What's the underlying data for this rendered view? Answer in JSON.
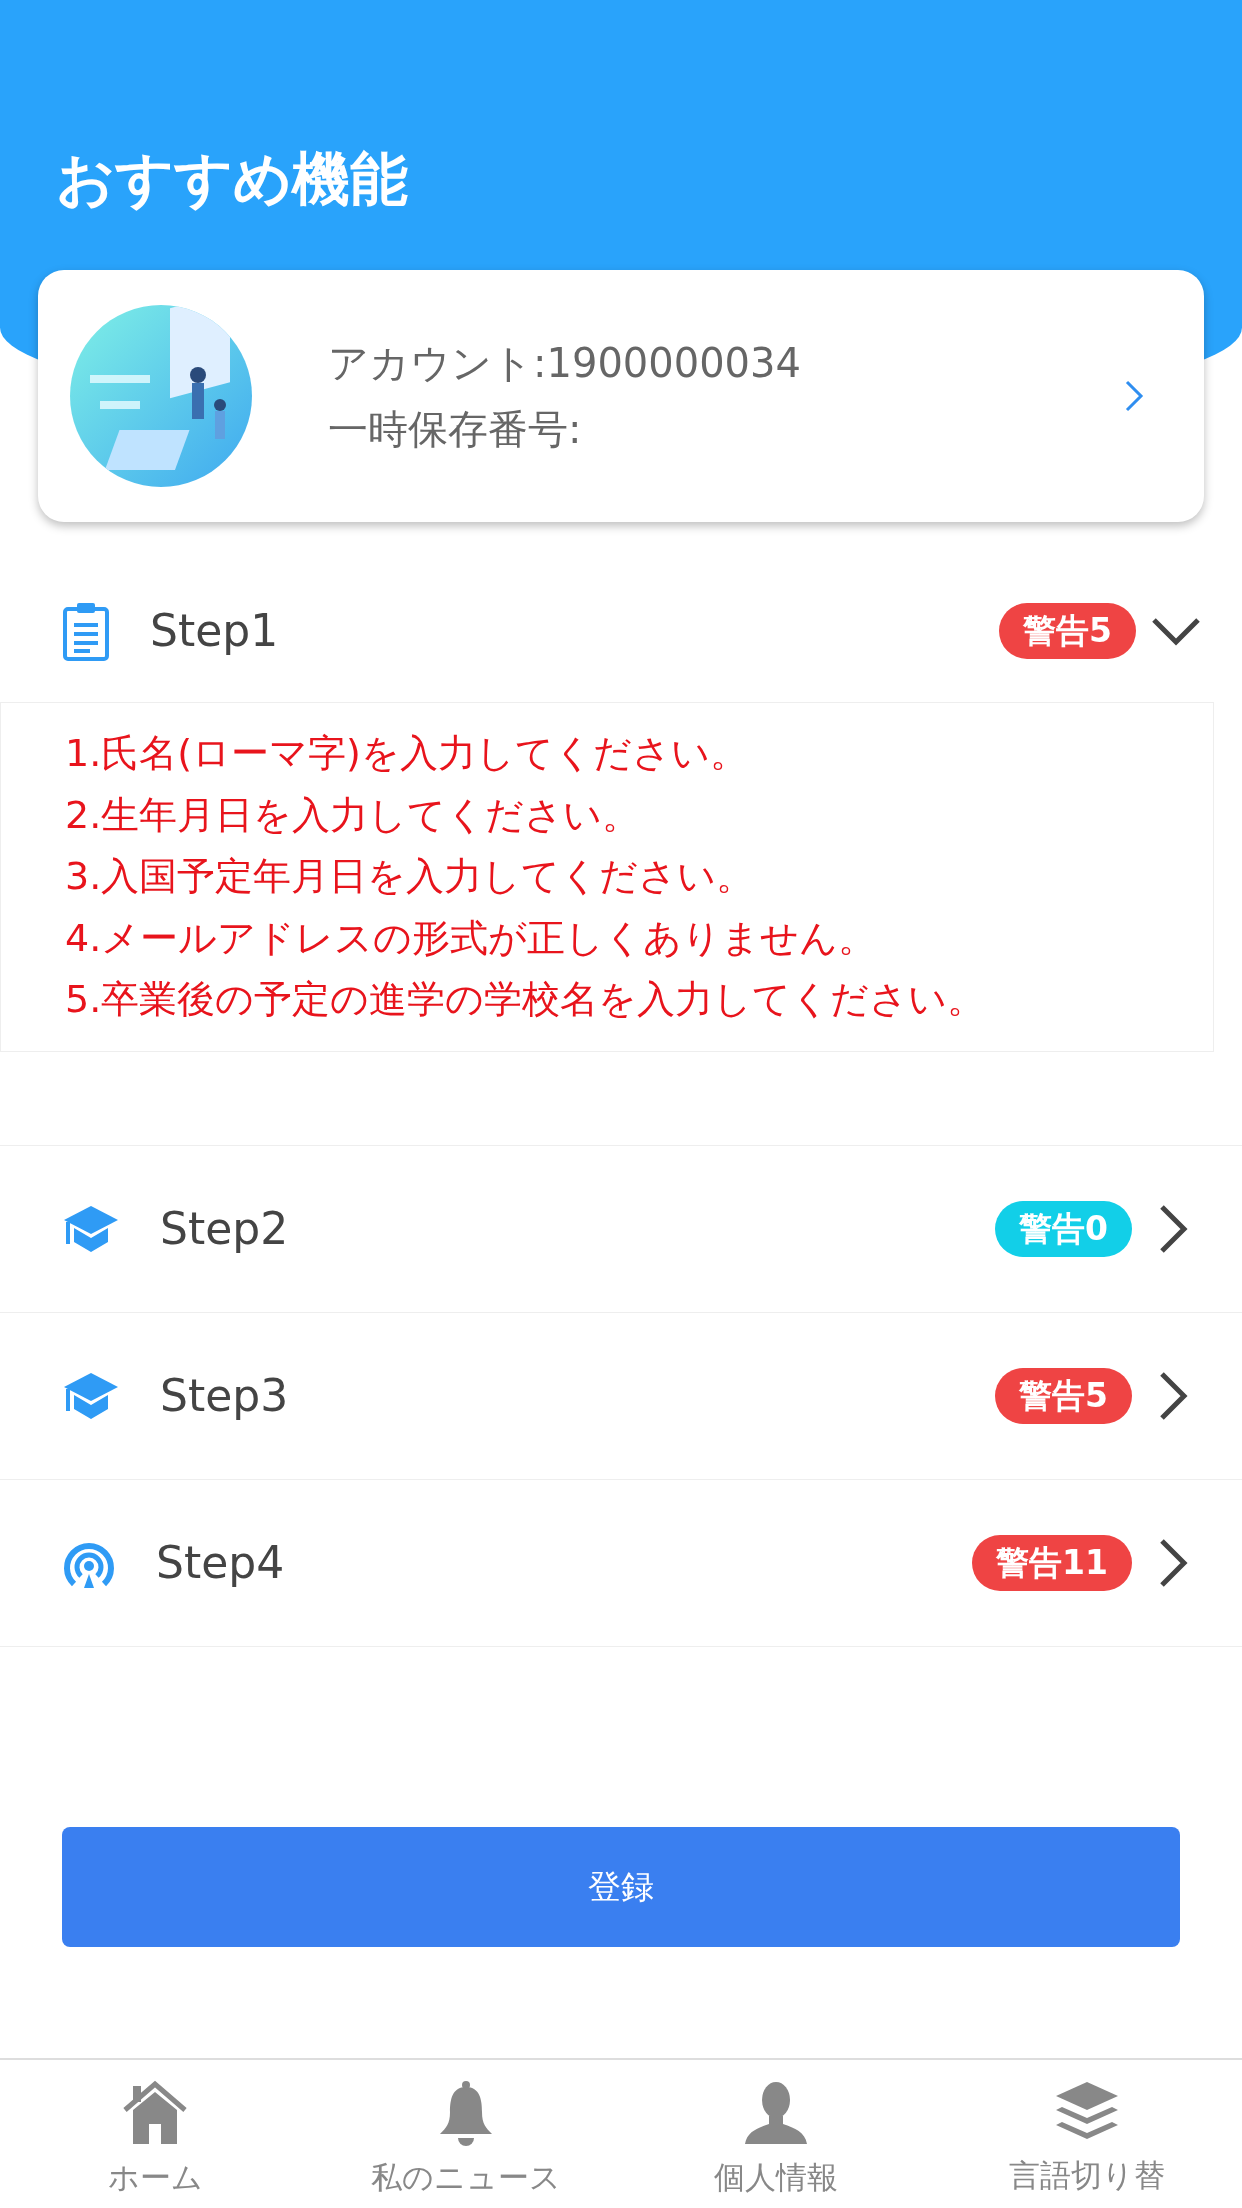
{
  "header": {
    "title": "おすすめ機能"
  },
  "account_card": {
    "account": "アカウント:1900000034",
    "temp_number": "一時保存番号:"
  },
  "steps": [
    {
      "kind": "clipboard",
      "label": "Step1",
      "badge": "警告5",
      "color": "#ef4444",
      "expanded": true,
      "messages": [
        "1.氏名(ローマ字)を入力してください。",
        "2.生年月日を入力してください。",
        "3.入国予定年月日を入力してください。",
        "4.メールアドレスの形式が正しくありません。",
        "5.卒業後の予定の進学の学校名を入力してください。"
      ]
    },
    {
      "kind": "cap",
      "label": "Step2",
      "badge": "警告0",
      "color": "#12cfe8",
      "expanded": false
    },
    {
      "kind": "cap",
      "label": "Step3",
      "badge": "警告5",
      "color": "#ef4444",
      "expanded": false
    },
    {
      "kind": "signal",
      "label": "Step4",
      "badge": "警告11",
      "color": "#ef4444",
      "expanded": false
    }
  ],
  "submit_button": "登録",
  "tab_bar": [
    {
      "kind": "home",
      "label": "ホーム"
    },
    {
      "kind": "bell",
      "label": "私のニュース"
    },
    {
      "kind": "person",
      "label": "個人情報"
    },
    {
      "kind": "layers",
      "label": "言語切り替"
    }
  ]
}
